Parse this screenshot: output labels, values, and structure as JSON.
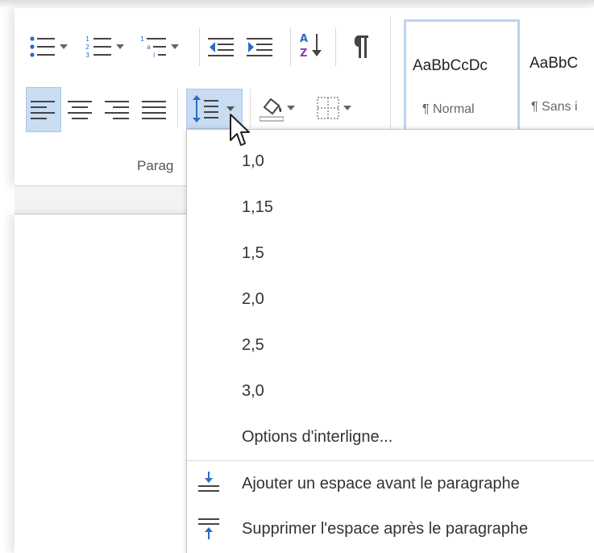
{
  "ribbon": {
    "group_label": "Parag",
    "styles": [
      {
        "sample": "AaBbCcDc",
        "name": "¶ Normal",
        "selected": true
      },
      {
        "sample": "AaBbC",
        "name": "¶ Sans i",
        "selected": false
      }
    ]
  },
  "line_spacing_menu": {
    "values": [
      "1,0",
      "1,15",
      "1,5",
      "2,0",
      "2,5",
      "3,0"
    ],
    "options_label": "Options d'interligne...",
    "add_before_label": "Ajouter un espace avant le paragraphe",
    "remove_after_label": "Supprimer l'espace après le paragraphe"
  },
  "colors": {
    "selected_fill": "#c8dcf2",
    "selected_border": "#aac8ea",
    "icon": "#444444",
    "accent_blue": "#2b6cc4"
  }
}
